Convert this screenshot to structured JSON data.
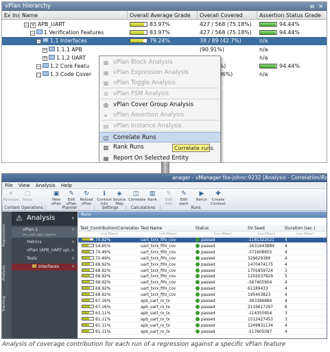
{
  "top": {
    "title": "vPlan Hierarchy",
    "columns": [
      "Ex",
      "Ins",
      "Name",
      "Overall Average Grade",
      "Overall Covered",
      "Assertion Status Grade"
    ],
    "rows": [
      {
        "name": "APB_UART",
        "grade": "83.97%",
        "grade_frac": 0.84,
        "covered": "427 / 568 (75.18%)",
        "assert": "94.44%",
        "assert_frac": 0.94,
        "indent": 0,
        "sel": false
      },
      {
        "name": "1 Verification Features",
        "grade": "83.97%",
        "grade_frac": 0.84,
        "covered": "427 / 568 (75.18%)",
        "assert": "94.44%",
        "assert_frac": 0.94,
        "indent": 1,
        "sel": false
      },
      {
        "name": "1.1 Interfaces",
        "grade": "79.24%",
        "grade_frac": 0.79,
        "covered": "38 / 89 (42.7%)",
        "assert": "n/a",
        "assert_frac": 0,
        "indent": 2,
        "sel": true
      },
      {
        "name": "1.1.1 APB",
        "grade": "",
        "grade_frac": 0,
        "covered": "(90.91%)",
        "assert": "n/a",
        "assert_frac": 0,
        "indent": 3,
        "sel": false
      },
      {
        "name": "1.1.2 UART",
        "grade": "",
        "grade_frac": 0,
        "covered": "(35.9%)",
        "assert": "n/a",
        "assert_frac": 0,
        "indent": 3,
        "sel": false
      },
      {
        "name": "1.2 Core Featu",
        "grade": "",
        "grade_frac": 0,
        "covered": "(9% 24%)",
        "assert": "94.44%",
        "assert_frac": 0.94,
        "indent": 2,
        "sel": false
      },
      {
        "name": "1.3 Code Cover",
        "grade": "",
        "grade_frac": 0,
        "covered": "37 (79.86%)",
        "assert": "n/a",
        "assert_frac": 0,
        "indent": 2,
        "sel": false
      }
    ],
    "menu": [
      {
        "label": "vPlan Block Analysis",
        "icon": "▦",
        "disabled": true
      },
      {
        "label": "vPlan Expression Analysis",
        "icon": "▦",
        "disabled": true
      },
      {
        "label": "vPlan Toggle Analysis",
        "icon": "▦",
        "disabled": true
      },
      {
        "label": "vPlan FSM Analysis",
        "icon": "⚙",
        "disabled": true
      },
      {
        "label": "vPlan Cover Group Analysis",
        "icon": "◎",
        "disabled": false
      },
      {
        "label": "vPlan Assertion Analysis",
        "icon": "▸",
        "disabled": true
      },
      {
        "label": "vPlan Instance Analysis",
        "icon": "▤",
        "disabled": true
      },
      {
        "label": "Correlate Runs",
        "icon": "◫",
        "disabled": false
      },
      {
        "label": "Rank Runs",
        "icon": "▥",
        "disabled": false
      },
      {
        "label": "Report On Selected Entity",
        "icon": "▤",
        "disabled": false
      }
    ],
    "tooltip": "Correlate runs"
  },
  "win": {
    "title": "anager - vManager fox-johnc:9232 [Analysis - Correlation/Rank]",
    "menu": [
      "File",
      "View",
      "Analysis",
      "Help"
    ],
    "toolbar": [
      {
        "label": "Remove",
        "icon": "✕",
        "dim": true
      },
      {
        "label": "Paste",
        "icon": "▢",
        "dim": true
      },
      {
        "label": "New vPlan",
        "icon": "▣",
        "dim": false
      },
      {
        "label": "Edit vPlan",
        "icon": "✎",
        "dim": false
      },
      {
        "label": "Reload vPlan",
        "icon": "↻",
        "dim": false
      },
      {
        "label": "Context Info",
        "icon": "ℹ",
        "dim": false
      },
      {
        "label": "Source Map",
        "icon": "◈",
        "dim": false
      },
      {
        "label": "Correlate",
        "icon": "◫",
        "dim": false
      },
      {
        "label": "Rank",
        "icon": "▥",
        "dim": false
      },
      {
        "label": "Edit Attr",
        "icon": "✎",
        "dim": true
      },
      {
        "label": "Edit each",
        "icon": "✎",
        "dim": false
      },
      {
        "label": "Rerun",
        "icon": "▶",
        "dim": false
      },
      {
        "label": "Create Context",
        "icon": "✚",
        "dim": false
      }
    ],
    "groups": [
      "Context Operations",
      "Planner",
      "Settings",
      "Calculations",
      "Runs"
    ],
    "side_tabs": [
      "Regressions",
      "Analysis",
      "Tracking"
    ],
    "analysis": {
      "heading": "Analysis",
      "items": [
        {
          "label": "vPlan 1",
          "sub": "vm_uart_apb_regress...",
          "hi": true
        },
        {
          "label": "Metrics",
          "sub": "",
          "hi": false
        },
        {
          "label": "vPlan (APB_UART.vpl...",
          "sub": "",
          "hi": false
        },
        {
          "label": "Tests",
          "sub": "",
          "hi": false
        },
        {
          "label": "Interfaces",
          "sub": "",
          "hi": false
        }
      ]
    },
    "runs": {
      "title": "Runs",
      "columns": [
        "Test_Contribution(Correlation)",
        "Test Name",
        "Status",
        "SV Seed",
        "Duration (sec.)"
      ],
      "filter": "(no filter)",
      "rows": [
        {
          "pct": "70.82%",
          "frac": 0.71,
          "test": "uart_txrx_fifo_cov",
          "status": "passed",
          "seed": "-1181322021",
          "dur": "4"
        },
        {
          "pct": "54.65%",
          "frac": 0.55,
          "test": "uart_txrx_fifo_cov",
          "status": "passed",
          "seed": "-1631643889",
          "dur": "4"
        },
        {
          "pct": "70.49%",
          "frac": 0.7,
          "test": "uart_txrx_fifo_cov",
          "status": "passed",
          "seed": "-371608655",
          "dur": "4"
        },
        {
          "pct": "70.49%",
          "frac": 0.7,
          "test": "uart_txrx_fifo_cov",
          "status": "passed",
          "seed": "329629389",
          "dur": "4"
        },
        {
          "pct": "68.92%",
          "frac": 0.69,
          "test": "uart_txrx_fifo_cov",
          "status": "passed",
          "seed": "1470474175",
          "dur": "4"
        },
        {
          "pct": "68.92%",
          "frac": 0.69,
          "test": "uart_txrx_fifo_cov",
          "status": "passed",
          "seed": "1705859724",
          "dur": "3"
        },
        {
          "pct": "68.92%",
          "frac": 0.69,
          "test": "uart_txrx_fifo_cov",
          "status": "passed",
          "seed": "1202037829",
          "dur": "5"
        },
        {
          "pct": "68.92%",
          "frac": 0.69,
          "test": "uart_txrx_fifo_cov",
          "status": "passed",
          "seed": "-567405904",
          "dur": "4"
        },
        {
          "pct": "68.92%",
          "frac": 0.69,
          "test": "uart_txrx_fifo_cov",
          "status": "passed",
          "seed": "61189433",
          "dur": "4"
        },
        {
          "pct": "68.92%",
          "frac": 0.69,
          "test": "uart_txrx_fifo_cov",
          "status": "passed",
          "seed": "195403823",
          "dur": "4"
        },
        {
          "pct": "67.16%",
          "frac": 0.67,
          "test": "apb_uart_rx_tx",
          "status": "passed",
          "seed": "-383386884",
          "dur": "4"
        },
        {
          "pct": "67.16%",
          "frac": 0.67,
          "test": "apb_uart_rx_tx",
          "status": "passed",
          "seed": "2116617297",
          "dur": "6"
        },
        {
          "pct": "61.11%",
          "frac": 0.61,
          "test": "apb_uart_rx_tx",
          "status": "passed",
          "seed": "-114350954",
          "dur": "3"
        },
        {
          "pct": "61.11%",
          "frac": 0.61,
          "test": "apb_uart_rx_tx",
          "status": "passed",
          "seed": "1512427453",
          "dur": "3"
        },
        {
          "pct": "61.11%",
          "frac": 0.61,
          "test": "apb_uart_rx_tx",
          "status": "passed",
          "seed": "1249931134",
          "dur": "4"
        },
        {
          "pct": "61.11%",
          "frac": 0.61,
          "test": "apb_uart_rx_tx",
          "status": "passed",
          "seed": "-517605097",
          "dur": "4"
        }
      ]
    }
  },
  "caption": "Analysis of coverage contribution for each run of a regression against a specific vPlan feature"
}
